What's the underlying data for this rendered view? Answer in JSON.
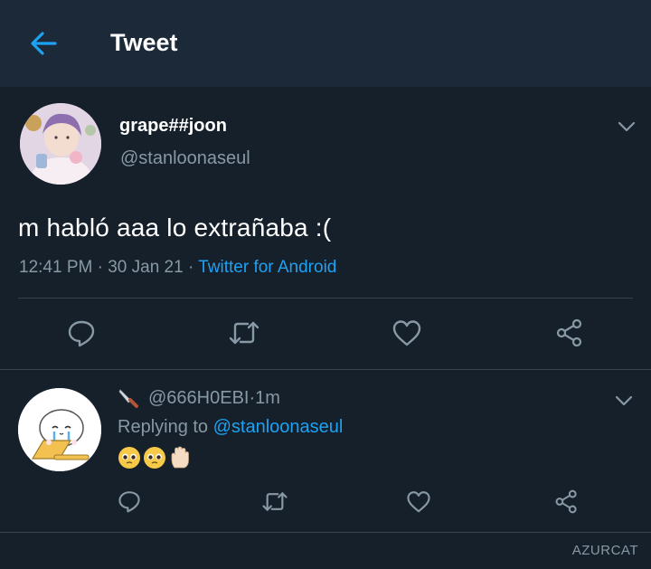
{
  "header": {
    "title": "Tweet",
    "back_icon": "arrow-left-icon",
    "accent_color": "#1da1f2"
  },
  "main_tweet": {
    "display_name": "grape##joon",
    "handle": "@stanloonaseul",
    "text": "m habló aaa lo extrañaba :(",
    "time": "12:41 PM",
    "separator1": " · ",
    "date": "30 Jan 21",
    "separator2": " · ",
    "source": "Twitter for Android",
    "actions": [
      "reply-icon",
      "retweet-icon",
      "like-icon",
      "share-icon"
    ]
  },
  "reply_tweet": {
    "prefix_icon": "knife-icon",
    "handle": "@666H0EBI",
    "separator": " · ",
    "age": "1m",
    "replying_label": "Replying to ",
    "replying_to": "@stanloonaseul",
    "emojis": [
      "pleading-face-icon",
      "pleading-face-icon",
      "raised-hand-icon"
    ],
    "actions": [
      "reply-icon",
      "retweet-icon",
      "like-icon",
      "share-icon"
    ]
  },
  "watermark": "AZURCAT",
  "colors": {
    "background": "#15202b",
    "header_background": "#1c2938",
    "secondary_text": "#8899a6",
    "divider": "#38444d",
    "link": "#1da1f2"
  }
}
